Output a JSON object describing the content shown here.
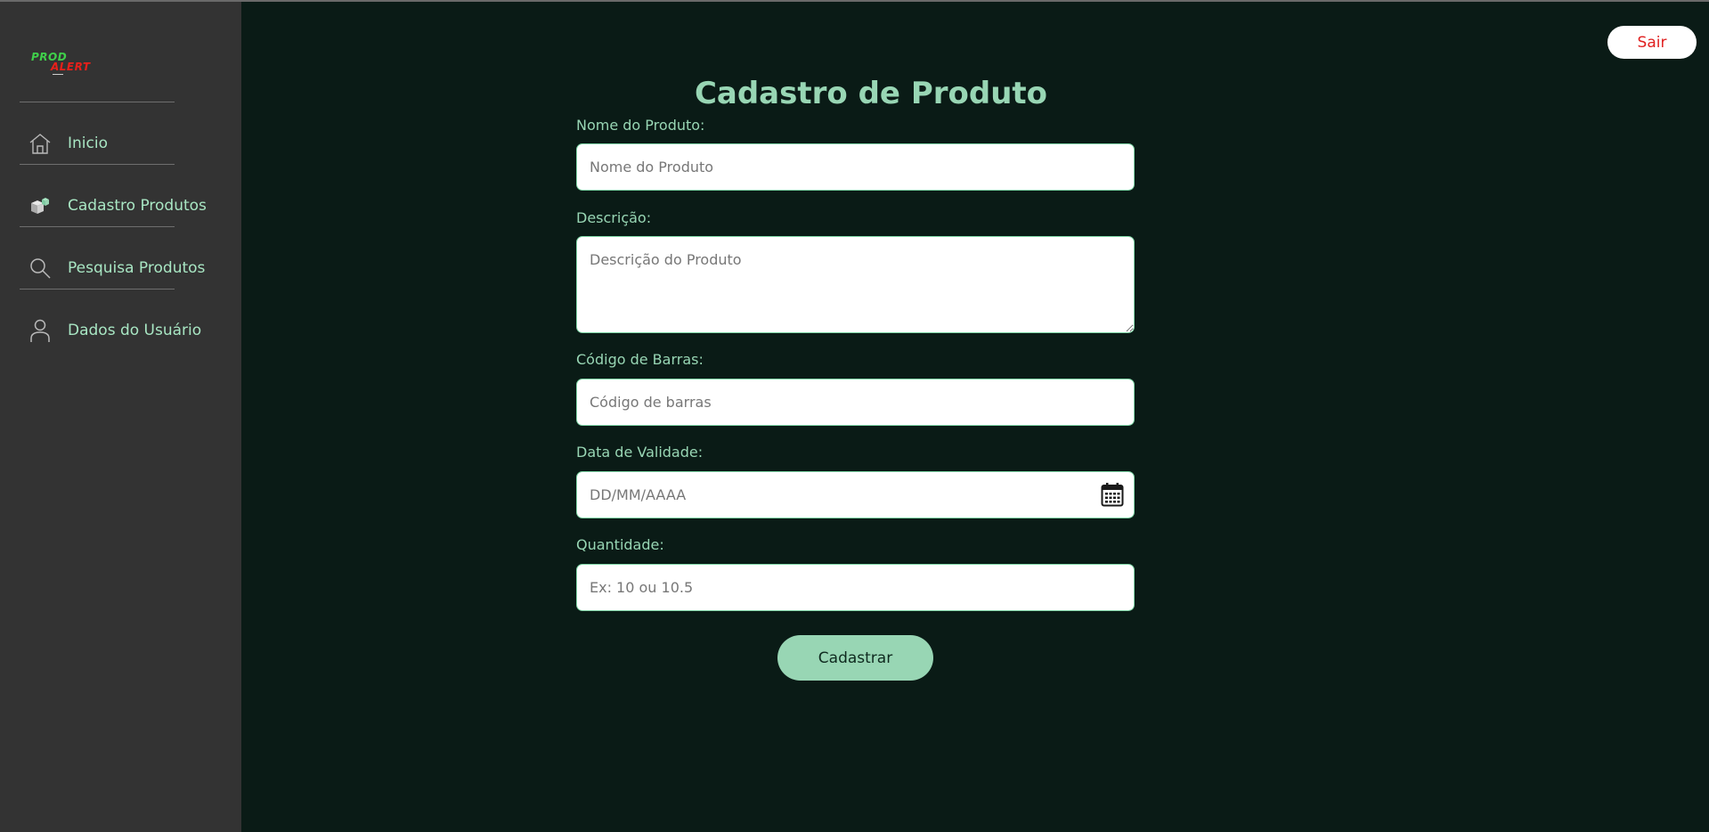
{
  "app": {
    "logo_top": "PROD",
    "logo_bottom": "ALERT"
  },
  "sidebar": {
    "items": [
      {
        "label": "Inicio",
        "icon": "home-icon"
      },
      {
        "label": "Cadastro Produtos",
        "icon": "boxes-icon"
      },
      {
        "label": "Pesquisa Produtos",
        "icon": "search-icon"
      },
      {
        "label": "Dados do Usuário",
        "icon": "user-icon"
      }
    ]
  },
  "header": {
    "logout_label": "Sair"
  },
  "form": {
    "title": "Cadastro de Produto",
    "fields": {
      "name": {
        "label": "Nome do Produto:",
        "placeholder": "Nome do Produto",
        "value": ""
      },
      "description": {
        "label": "Descrição:",
        "placeholder": "Descrição do Produto",
        "value": ""
      },
      "barcode": {
        "label": "Código de Barras:",
        "placeholder": "Código de barras",
        "value": ""
      },
      "expiry": {
        "label": "Data de Validade:",
        "placeholder": "DD/MM/AAAA",
        "value": "",
        "icon": "calendar-icon"
      },
      "quantity": {
        "label": "Quantidade:",
        "placeholder": "Ex: 10 ou 10.5",
        "value": ""
      }
    },
    "submit_label": "Cadastrar"
  },
  "colors": {
    "page_bg": "#0a1b16",
    "sidebar_bg": "#333333",
    "accent": "#98d6b4",
    "logout_text": "#e02020"
  }
}
